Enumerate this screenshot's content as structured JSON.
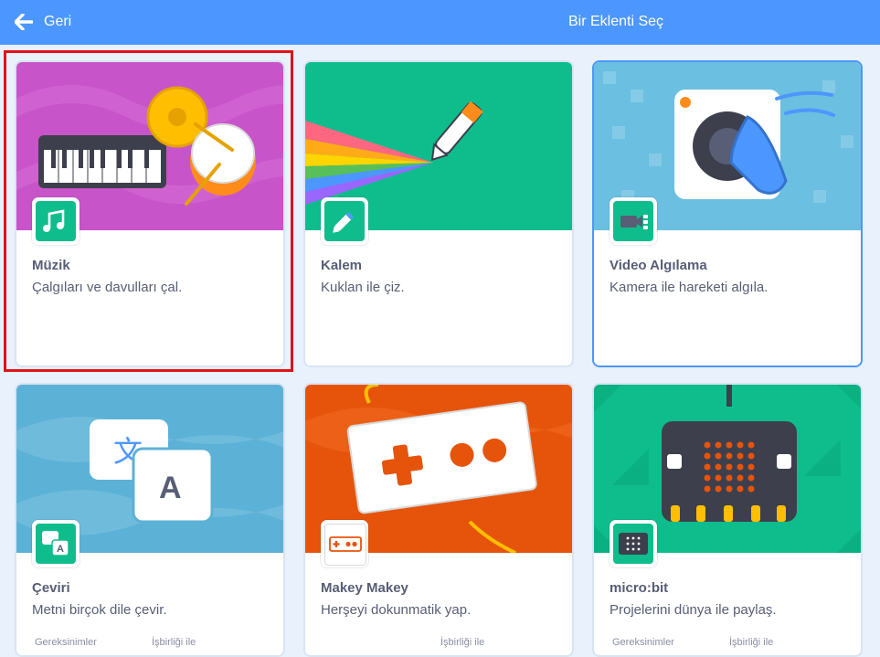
{
  "header": {
    "back_label": "Geri",
    "title": "Bir Eklenti Seç",
    "background": "#4c97ff"
  },
  "extensions": [
    {
      "name": "Müzik",
      "description": "Çalgıları ve davulları çal.",
      "icon": "music-notes-icon",
      "selected": true
    },
    {
      "name": "Kalem",
      "description": "Kuklan ile çiz.",
      "icon": "pen-icon"
    },
    {
      "name": "Video Algılama",
      "description": "Kamera ile hareketi algıla.",
      "icon": "video-camera-icon",
      "hovered": true
    },
    {
      "name": "Çeviri",
      "description": "Metni birçok dile çevir.",
      "icon": "translate-icon",
      "requirements_label": "Gereksinimler",
      "collaboration_label": "İşbirliği ile"
    },
    {
      "name": "Makey Makey",
      "description": "Herşeyi dokunmatik yap.",
      "icon": "makey-makey-icon",
      "collaboration_label": "İşbirliği ile"
    },
    {
      "name": "micro:bit",
      "description": "Projelerini dünya ile paylaş.",
      "icon": "microbit-icon",
      "requirements_label": "Gereksinimler",
      "collaboration_label": "İşbirliği ile"
    }
  ],
  "colors": {
    "accent": "#4c97ff",
    "selection_outline": "#e0121e",
    "text": "#575e75",
    "badge_green": "#0fbd8c"
  }
}
